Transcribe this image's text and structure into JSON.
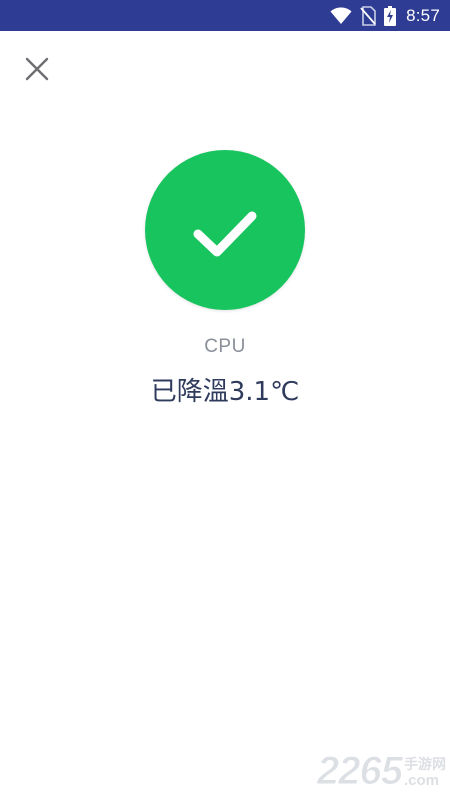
{
  "status_bar": {
    "time": "8:57",
    "icons": [
      "wifi-icon",
      "no-sim-icon",
      "battery-charging-icon"
    ],
    "background": "#2e3c94"
  },
  "close_button": {
    "icon": "close-icon"
  },
  "result": {
    "icon": "checkmark-icon",
    "circle_color": "#17c45e",
    "component": "CPU",
    "message": "已降溫3.1℃"
  },
  "watermark": {
    "number": "2265",
    "cn": "手游网",
    "suffix": ".com"
  }
}
